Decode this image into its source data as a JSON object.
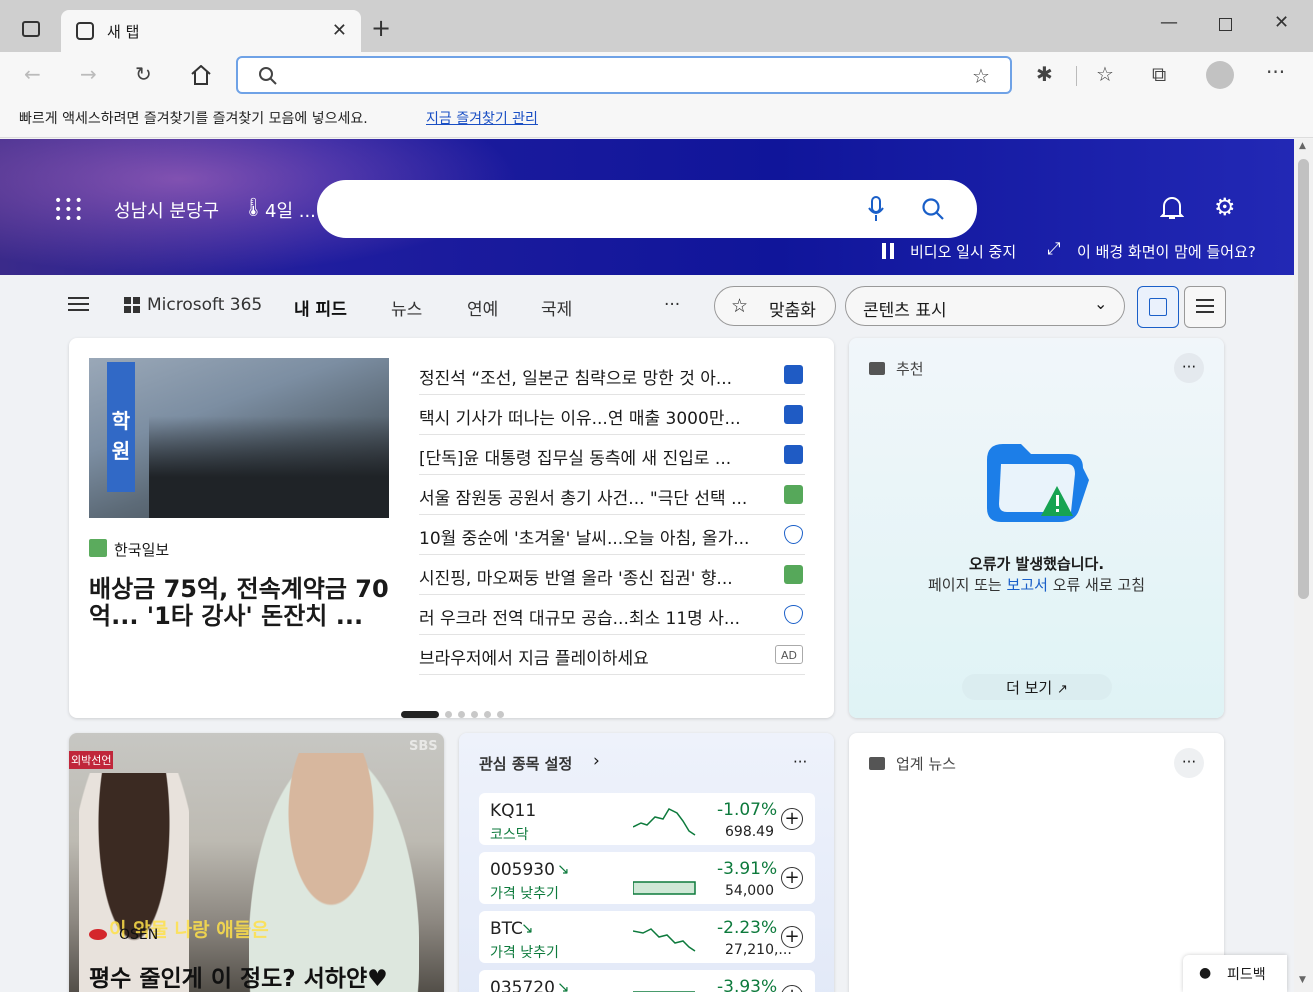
{
  "tab": {
    "title": "새 탭"
  },
  "favorites_bar": {
    "message": "빠르게 액세스하려면 즐겨찾기를 즐겨찾기 모음에 넣으세요.",
    "link": "지금 즐겨찾기 관리"
  },
  "hero": {
    "location": "성남시 분당구",
    "weather": "4일 ...",
    "pause_video": "비디오 일시 중지",
    "like_background": "이 배경 화면이 맘에 들어요?"
  },
  "feed_nav": {
    "ms365": "Microsoft 365",
    "tabs": [
      "내 피드",
      "뉴스",
      "연예",
      "국제"
    ],
    "more": "···",
    "personalize": "맞춤화",
    "content_select": "콘텐츠 표시"
  },
  "top_story": {
    "source": "한국일보",
    "headline": "배상금 75억, 전속계약금 70억... '1타 강사' 돈잔치 ..."
  },
  "headlines": [
    {
      "text": "정진석 “조선, 일본군 침략으로 망한 것 아...",
      "src": "blue"
    },
    {
      "text": "택시 기사가 떠나는 이유...연 매출 3000만...",
      "src": "blue"
    },
    {
      "text": "[단독]윤 대통령 집무실 동측에 새 진입로 ...",
      "src": "blue"
    },
    {
      "text": "서울 잠원동 공원서 총기 사건... \"극단 선택 ...",
      "src": "green"
    },
    {
      "text": "10월 중순에 '초겨울' 날씨...오늘 아침, 올가...",
      "src": "shield"
    },
    {
      "text": "시진핑, 마오쩌둥 반열 올라 '종신 집권' 향...",
      "src": "green"
    },
    {
      "text": "러 우크라 전역 대규모 공습...최소 11명 사...",
      "src": "shield"
    },
    {
      "text": "브라우저에서 지금 플레이하세요",
      "src": "ad"
    }
  ],
  "ad_label": "AD",
  "recommend": {
    "title": "추천",
    "more": "···",
    "error_title": "오류가 발생했습니다.",
    "error_pre": "페이지 또는 ",
    "error_link": "보고서",
    "error_post": " 오류 새로 고침",
    "see_more": "더 보기"
  },
  "video_story": {
    "badge": "외박선언",
    "source": "OSEN",
    "overlay": "이 악물 나랑 애들은",
    "headline": "평수 줄인게 이 정도? 서하얀♥",
    "watermark": "SBS"
  },
  "stocks": {
    "title": "관심 종목 설정",
    "more": "···",
    "rows": [
      {
        "name": "KQ11",
        "sub": "코스닥",
        "pct": "-1.07%",
        "value": "698.49"
      },
      {
        "name": "005930",
        "sub": "가격 낮추기",
        "pct": "-3.91%",
        "value": "54,000"
      },
      {
        "name": "BTC",
        "sub": "가격 낮추기",
        "pct": "-2.23%",
        "value": "27,210,..."
      },
      {
        "name": "035720",
        "sub": "",
        "pct": "-3.93%",
        "value": ""
      }
    ]
  },
  "industry": {
    "title": "업계 뉴스",
    "more": "···"
  },
  "feedback": "피드백"
}
